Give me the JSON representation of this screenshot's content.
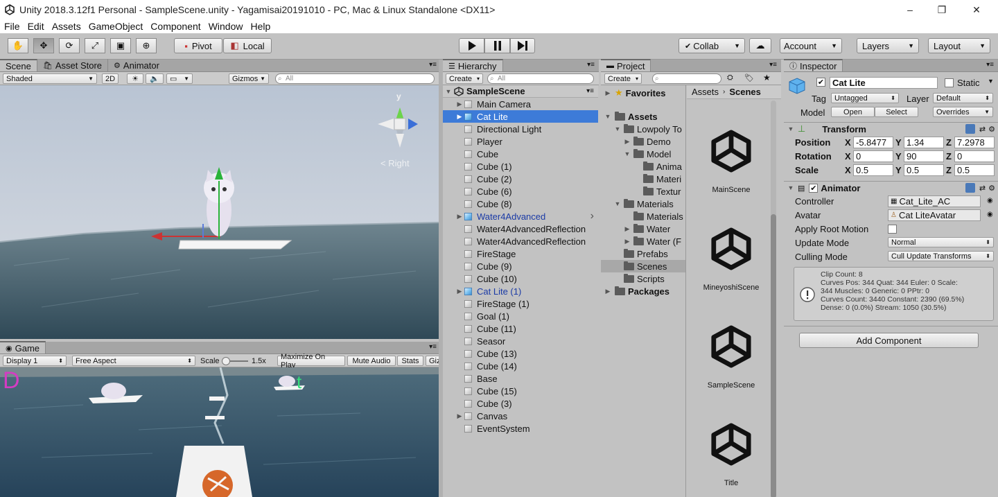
{
  "window": {
    "title": "Unity 2018.3.12f1 Personal - SampleScene.unity - Yagamisai20191010 - PC, Mac & Linux Standalone <DX11>",
    "min": "–",
    "max": "❐",
    "close": "✕"
  },
  "menu": [
    "File",
    "Edit",
    "Assets",
    "GameObject",
    "Component",
    "Window",
    "Help"
  ],
  "toolbar": {
    "pivot": "Pivot",
    "local": "Local",
    "collab": "Collab",
    "account": "Account",
    "layers": "Layers",
    "layout": "Layout"
  },
  "scene": {
    "tabs": [
      "Scene",
      "Asset Store",
      "Animator"
    ],
    "shading": "Shaded",
    "mode2d": "2D",
    "gizmos": "Gizmos",
    "search": "All",
    "right_label": "< Right",
    "gizmo_y": "y"
  },
  "game": {
    "tab": "Game",
    "display": "Display 1",
    "aspect": "Free Aspect",
    "scale_label": "Scale",
    "scale_value": "1.5x",
    "maximize": "Maximize On Play",
    "mute": "Mute Audio",
    "stats": "Stats",
    "gizmos": "Giz",
    "overlay_left": "D",
    "overlay_right": "t"
  },
  "hierarchy": {
    "tab": "Hierarchy",
    "create": "Create",
    "search": "All",
    "scene": "SampleScene",
    "items": [
      {
        "label": "Main Camera",
        "arrow": true,
        "color": "#111",
        "icon": "cube"
      },
      {
        "label": "Cat Lite",
        "arrow": true,
        "color": "#fff",
        "icon": "blue",
        "selected": true
      },
      {
        "label": "Directional Light",
        "arrow": false,
        "color": "#111",
        "icon": "cube"
      },
      {
        "label": "Player",
        "arrow": false,
        "color": "#111",
        "icon": "cube"
      },
      {
        "label": "Cube",
        "arrow": false,
        "color": "#111",
        "icon": "cube"
      },
      {
        "label": "Cube (1)",
        "arrow": false,
        "color": "#111",
        "icon": "cube"
      },
      {
        "label": "Cube (2)",
        "arrow": false,
        "color": "#111",
        "icon": "cube"
      },
      {
        "label": "Cube (6)",
        "arrow": false,
        "color": "#111",
        "icon": "cube"
      },
      {
        "label": "Cube (8)",
        "arrow": false,
        "color": "#111",
        "icon": "cube"
      },
      {
        "label": "Water4Advanced",
        "arrow": true,
        "color": "#1a3aa6",
        "icon": "blue",
        "chevron": true
      },
      {
        "label": "Water4AdvancedReflection",
        "arrow": false,
        "color": "#111",
        "icon": "cube"
      },
      {
        "label": "Water4AdvancedReflection",
        "arrow": false,
        "color": "#111",
        "icon": "cube"
      },
      {
        "label": "FireStage",
        "arrow": false,
        "color": "#111",
        "icon": "cube"
      },
      {
        "label": "Cube (9)",
        "arrow": false,
        "color": "#111",
        "icon": "cube"
      },
      {
        "label": "Cube (10)",
        "arrow": false,
        "color": "#111",
        "icon": "cube"
      },
      {
        "label": "Cat Lite (1)",
        "arrow": true,
        "color": "#1a3aa6",
        "icon": "blue"
      },
      {
        "label": "FireStage (1)",
        "arrow": false,
        "color": "#111",
        "icon": "cube"
      },
      {
        "label": "Goal (1)",
        "arrow": false,
        "color": "#111",
        "icon": "cube"
      },
      {
        "label": "Cube (11)",
        "arrow": false,
        "color": "#111",
        "icon": "cube"
      },
      {
        "label": "Seasor",
        "arrow": false,
        "color": "#111",
        "icon": "cube"
      },
      {
        "label": "Cube (13)",
        "arrow": false,
        "color": "#111",
        "icon": "cube"
      },
      {
        "label": "Cube (14)",
        "arrow": false,
        "color": "#111",
        "icon": "cube"
      },
      {
        "label": "Base",
        "arrow": false,
        "color": "#111",
        "icon": "cube"
      },
      {
        "label": "Cube (15)",
        "arrow": false,
        "color": "#111",
        "icon": "cube"
      },
      {
        "label": "Cube (3)",
        "arrow": false,
        "color": "#111",
        "icon": "cube"
      },
      {
        "label": "Canvas",
        "arrow": true,
        "color": "#111",
        "icon": "cube"
      },
      {
        "label": "EventSystem",
        "arrow": false,
        "color": "#111",
        "icon": "cube"
      }
    ]
  },
  "project": {
    "tab": "Project",
    "create": "Create",
    "favorites": "Favorites",
    "assets": "Assets",
    "packages": "Packages",
    "tree": [
      {
        "label": "Lowpoly To",
        "arrow": "▼",
        "depth": 1
      },
      {
        "label": "Demo",
        "arrow": "▶",
        "depth": 2
      },
      {
        "label": "Model",
        "arrow": "▼",
        "depth": 2
      },
      {
        "label": "Anima",
        "arrow": "",
        "depth": 3
      },
      {
        "label": "Materi",
        "arrow": "",
        "depth": 3
      },
      {
        "label": "Textur",
        "arrow": "",
        "depth": 3
      },
      {
        "label": "Materials",
        "arrow": "▼",
        "depth": 1
      },
      {
        "label": "Materials",
        "arrow": "",
        "depth": 2
      },
      {
        "label": "Water",
        "arrow": "▶",
        "depth": 2
      },
      {
        "label": "Water (F",
        "arrow": "▶",
        "depth": 2
      },
      {
        "label": "Prefabs",
        "arrow": "",
        "depth": 1
      },
      {
        "label": "Scenes",
        "arrow": "",
        "depth": 1,
        "selected": true
      },
      {
        "label": "Scripts",
        "arrow": "",
        "depth": 1
      }
    ],
    "breadcrumb": [
      "Assets",
      "Scenes"
    ],
    "scenes": [
      "MainScene",
      "MineyoshiScene",
      "SampleScene",
      "Title"
    ]
  },
  "inspector": {
    "tab": "Inspector",
    "name": "Cat Lite",
    "static": "Static",
    "tag_label": "Tag",
    "tag": "Untagged",
    "layer_label": "Layer",
    "layer": "Default",
    "model_label": "Model",
    "open": "Open",
    "select": "Select",
    "overrides": "Overrides",
    "transform": {
      "title": "Transform",
      "position_label": "Position",
      "rotation_label": "Rotation",
      "scale_label": "Scale",
      "position": {
        "x": "-5.8477",
        "y": "1.34",
        "z": "7.2978"
      },
      "rotation": {
        "x": "0",
        "y": "90",
        "z": "0"
      },
      "scale": {
        "x": "0.5",
        "y": "0.5",
        "z": "0.5"
      }
    },
    "animator": {
      "title": "Animator",
      "controller_label": "Controller",
      "controller": "Cat_Lite_AC",
      "avatar_label": "Avatar",
      "avatar": "Cat LiteAvatar",
      "apply_root_label": "Apply Root Motion",
      "update_label": "Update Mode",
      "update": "Normal",
      "culling_label": "Culling Mode",
      "culling": "Cull Update Transforms",
      "info": [
        "Clip Count: 8",
        "Curves Pos: 344 Quat: 344 Euler: 0 Scale:",
        "344 Muscles: 0 Generic: 0 PPtr: 0",
        "Curves Count: 3440 Constant: 2390 (69.5%)",
        "Dense: 0 (0.0%) Stream: 1050 (30.5%)"
      ]
    },
    "add_component": "Add Component",
    "axis": {
      "x": "X",
      "y": "Y",
      "z": "Z"
    }
  }
}
